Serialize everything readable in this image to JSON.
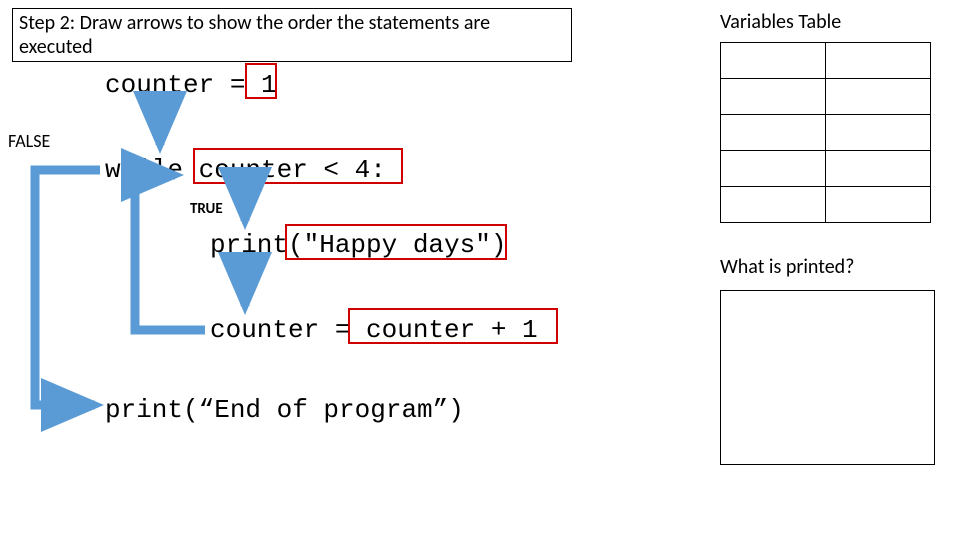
{
  "step_title": "Step 2: Draw arrows to show the order the statements are executed",
  "code": {
    "line1": "counter = 1",
    "line2": "while counter < 4:",
    "line3": "print(\"Happy days\")",
    "line4": "counter = counter + 1",
    "line5": "print(“End of program”)"
  },
  "labels": {
    "false": "FALSE",
    "true": "TRUE"
  },
  "right": {
    "variables_title": "Variables Table",
    "printed_title": "What is printed?"
  },
  "variables_table": {
    "rows": 5,
    "cols": 2
  },
  "colors": {
    "arrow": "#5b9bd5",
    "red": "#d00000",
    "black": "#000000"
  }
}
